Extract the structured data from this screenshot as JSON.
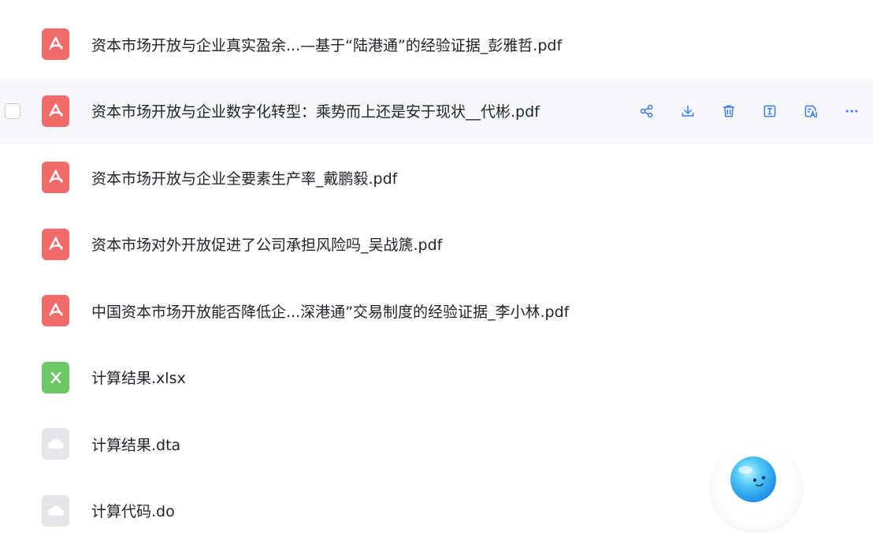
{
  "files": [
    {
      "name": "资本市场开放与企业真实盈余...—基于“陆港通”的经验证据_彭雅哲.pdf",
      "type": "pdf"
    },
    {
      "name": "资本市场开放与企业数字化转型：乘势而上还是安于现状__代彬.pdf",
      "type": "pdf"
    },
    {
      "name": "资本市场开放与企业全要素生产率_戴鹏毅.pdf",
      "type": "pdf"
    },
    {
      "name": "资本市场对外开放促进了公司承担风险吗_吴战篪.pdf",
      "type": "pdf"
    },
    {
      "name": "中国资本市场开放能否降低企...深港通”交易制度的经验证据_李小林.pdf",
      "type": "pdf"
    },
    {
      "name": "计算结果.xlsx",
      "type": "xlsx"
    },
    {
      "name": "计算结果.dta",
      "type": "cloud"
    },
    {
      "name": "计算代码.do",
      "type": "cloud"
    }
  ],
  "row_actions": [
    {
      "icon": "share-icon"
    },
    {
      "icon": "download-icon"
    },
    {
      "icon": "trash-icon"
    },
    {
      "icon": "rename-icon"
    },
    {
      "icon": "ai-read-icon"
    },
    {
      "icon": "more-icon"
    }
  ],
  "colors": {
    "accent": "#3b7cf4",
    "pdf": "#f26b6b",
    "xlsx": "#6cc764",
    "cloud_file": "#e4e6ea",
    "hover_row": "#f6f8fb"
  },
  "hovered_row": 1,
  "assistant": {
    "icon": "ai-assistant-avatar-icon"
  }
}
